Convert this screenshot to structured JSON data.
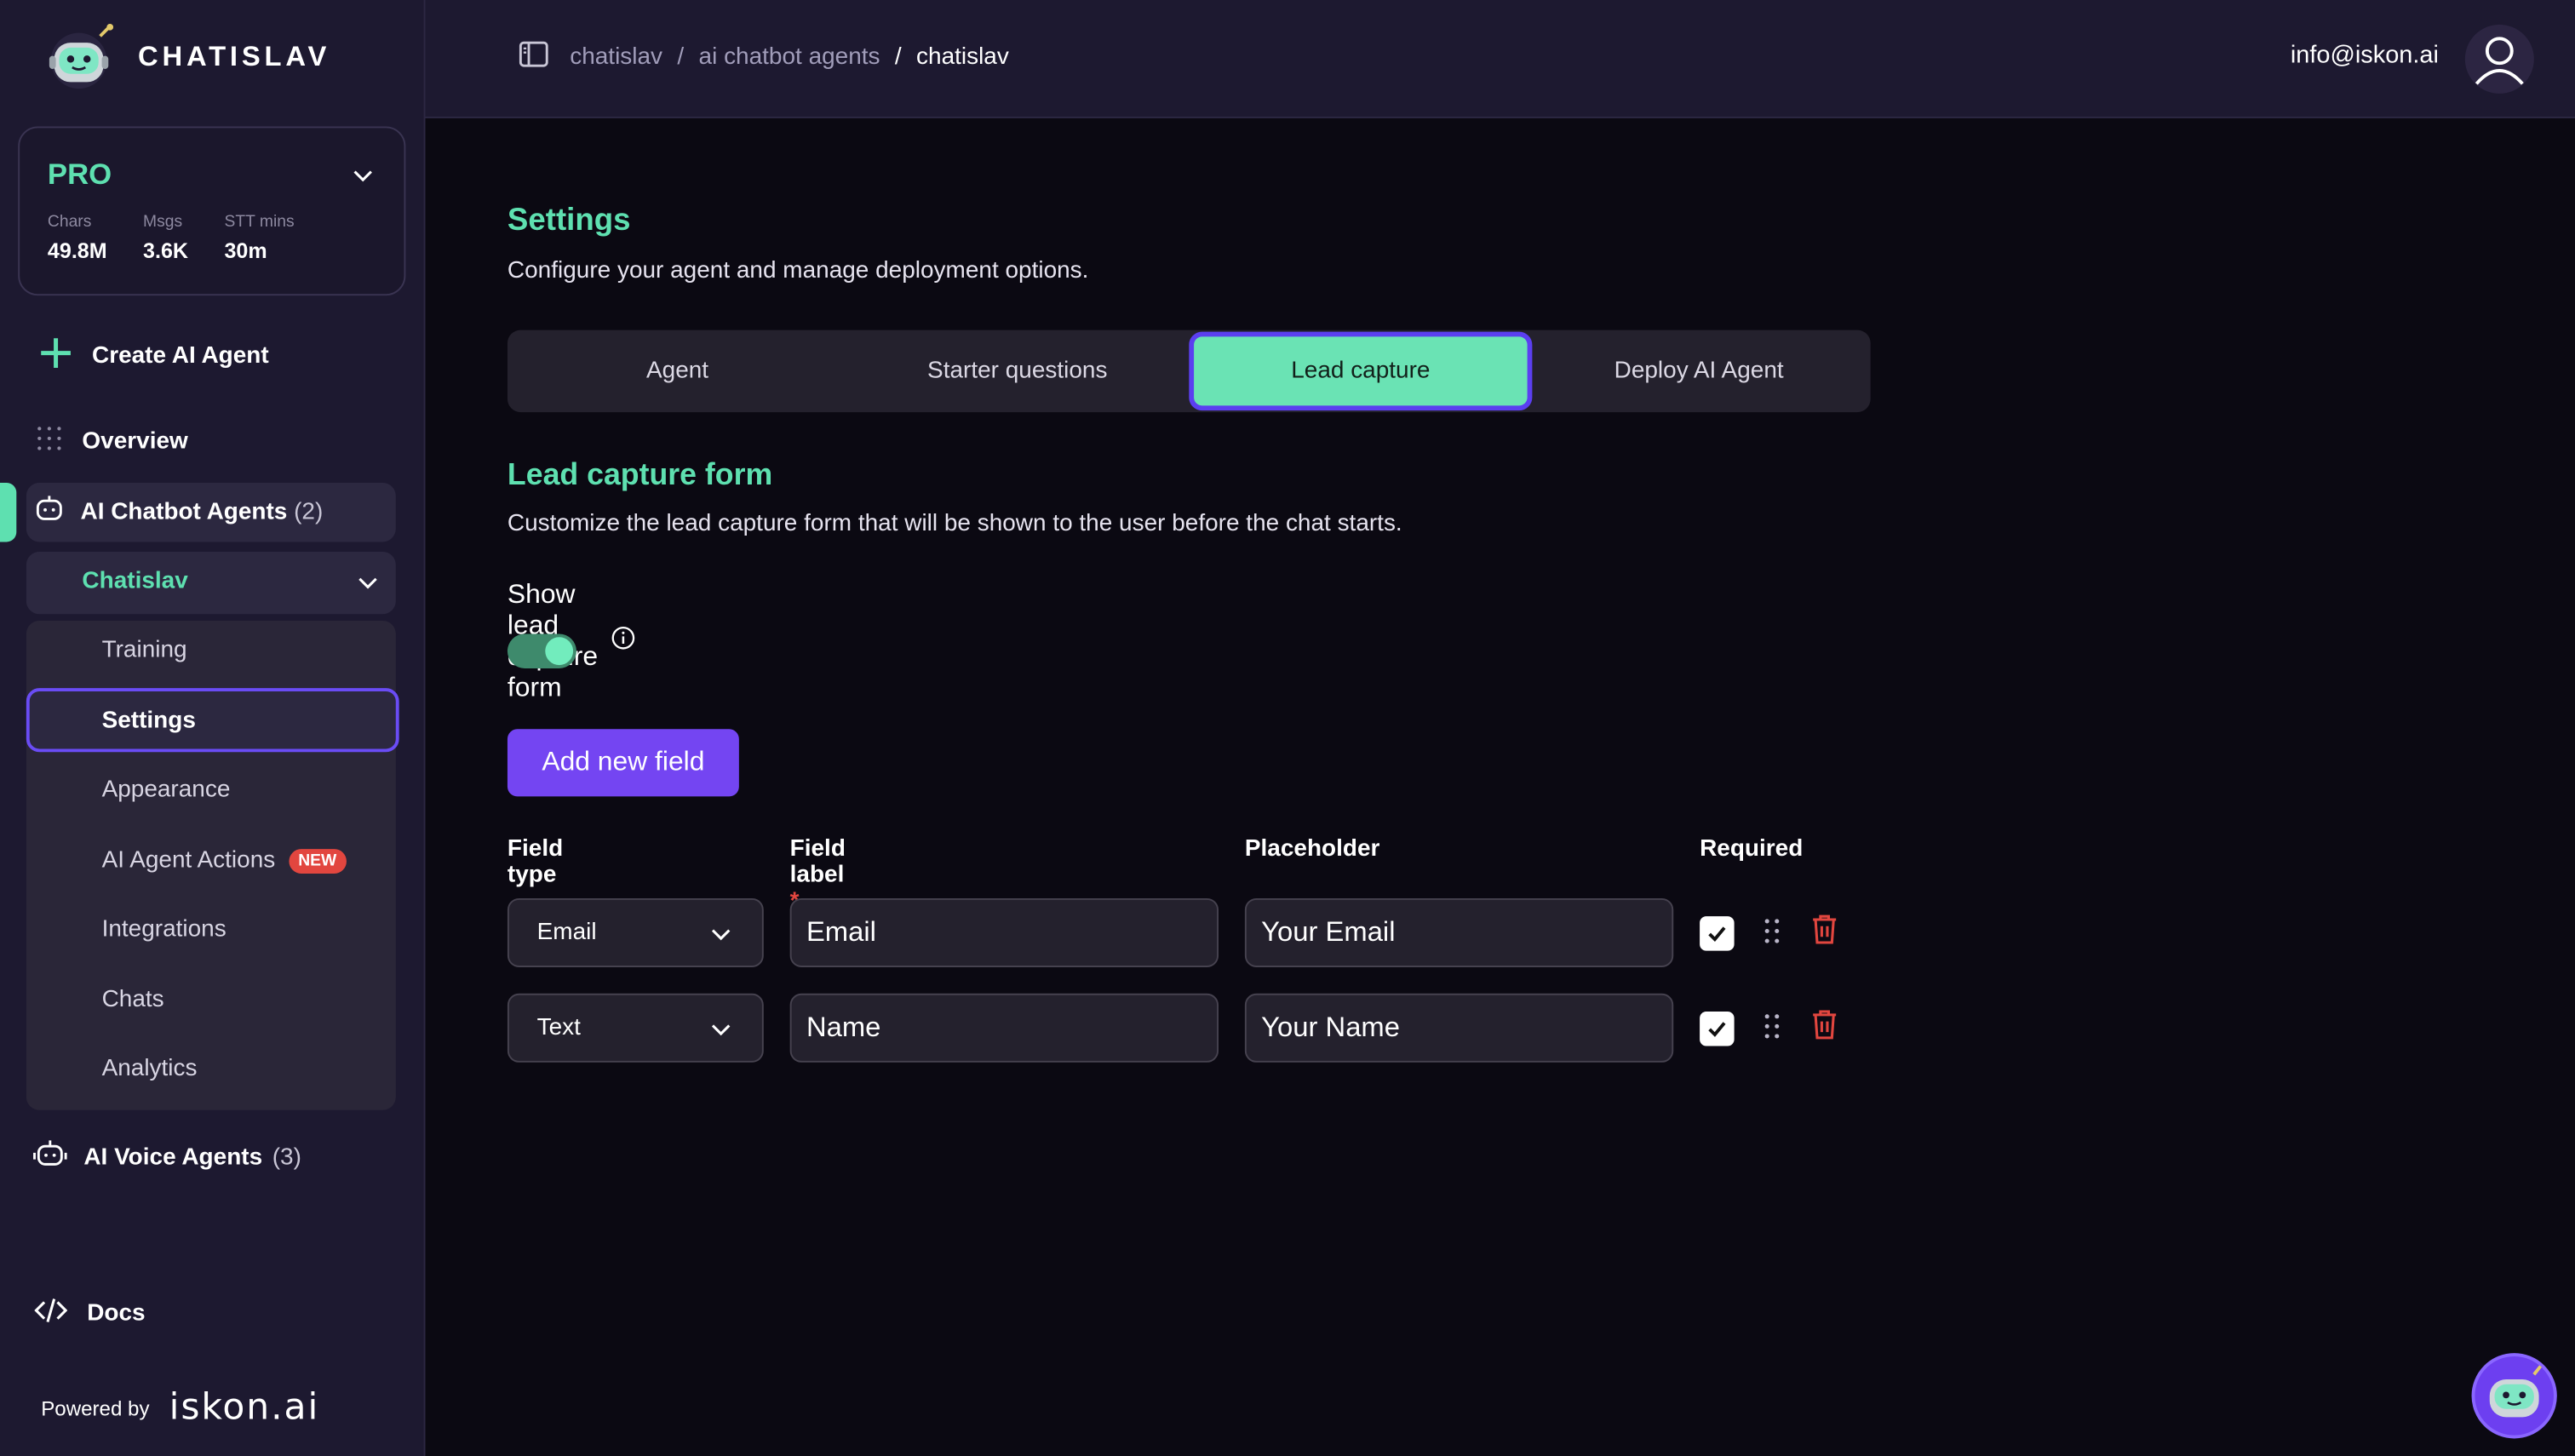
{
  "brand": {
    "name": "CHATISLAV"
  },
  "plan": {
    "name": "PRO",
    "stats": [
      {
        "label": "Chars",
        "value": "49.8M"
      },
      {
        "label": "Msgs",
        "value": "3.6K"
      },
      {
        "label": "STT mins",
        "value": "30m"
      }
    ]
  },
  "sidebar": {
    "create_agent": "Create AI Agent",
    "overview": "Overview",
    "chatbot_agents": {
      "label": "AI Chatbot Agents",
      "count": "(2)"
    },
    "agent": {
      "name": "Chatislav"
    },
    "sub_items": {
      "training": "Training",
      "settings": "Settings",
      "appearance": "Appearance",
      "actions": "AI Agent Actions",
      "actions_badge": "NEW",
      "integrations": "Integrations",
      "chats": "Chats",
      "analytics": "Analytics"
    },
    "voice_agents": {
      "label": "AI Voice Agents",
      "count": "(3)"
    },
    "docs": "Docs",
    "powered_label": "Powered by",
    "powered_logo": "iskon.ai"
  },
  "header": {
    "breadcrumb": [
      "chatislav",
      "ai chatbot agents",
      "chatislav"
    ],
    "separator": "/",
    "email": "info@iskon.ai"
  },
  "page": {
    "title": "Settings",
    "subtitle": "Configure your agent and manage deployment options.",
    "tabs": [
      "Agent",
      "Starter questions",
      "Lead capture",
      "Deploy AI Agent"
    ],
    "active_tab": "Lead capture"
  },
  "lead_capture": {
    "title": "Lead capture form",
    "subtitle": "Customize the lead capture form that will be shown to the user before the chat starts.",
    "show_label": "Show lead capture form",
    "show_enabled": true,
    "add_button": "Add new field",
    "columns": {
      "field_type": "Field type",
      "field_label": "Field label",
      "required_mark": "*",
      "placeholder": "Placeholder",
      "required": "Required"
    },
    "rows": [
      {
        "type": "Email",
        "label": "Email",
        "placeholder": "Your Email",
        "required": true
      },
      {
        "type": "Text",
        "label": "Name",
        "placeholder": "Your Name",
        "required": true
      }
    ]
  },
  "colors": {
    "accent_green": "#5ee0b0",
    "accent_purple": "#7445f2",
    "danger": "#e2463f",
    "sidebar_bg": "#1d1930",
    "page_bg": "#0b0912"
  }
}
